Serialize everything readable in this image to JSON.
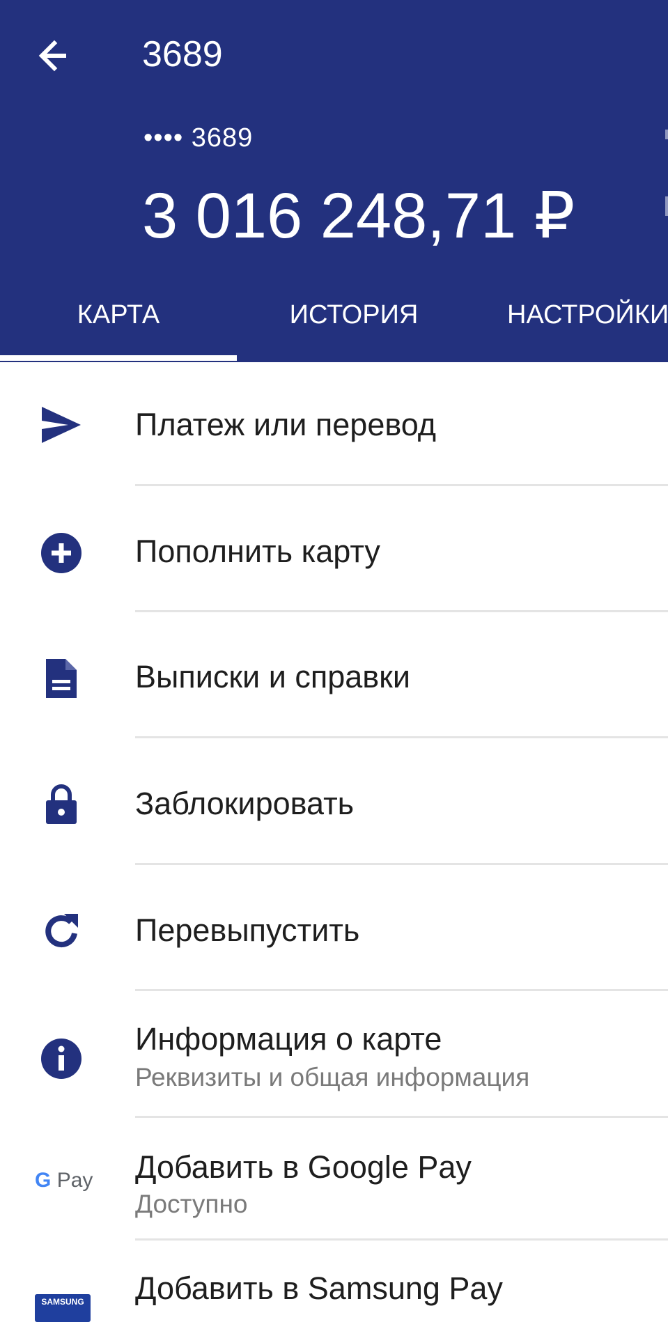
{
  "header": {
    "title": "3689",
    "masked_number": "•••• 3689",
    "balance": "3 016 248,71 ₽",
    "background_color": "#23317e",
    "back_icon": "arrow-left-icon"
  },
  "tabs": [
    {
      "label": "КАРТА",
      "active": true
    },
    {
      "label": "ИСТОРИЯ",
      "active": false
    },
    {
      "label": "НАСТРОЙКИ",
      "active": false
    }
  ],
  "menu": {
    "items": [
      {
        "label": "Платеж или перевод",
        "icon": "send-icon"
      },
      {
        "label": "Пополнить карту",
        "icon": "add-circle-icon"
      },
      {
        "label": "Выписки и справки",
        "icon": "document-icon"
      },
      {
        "label": "Заблокировать",
        "icon": "lock-icon"
      },
      {
        "label": "Перевыпустить",
        "icon": "refresh-icon"
      },
      {
        "label": "Информация о карте",
        "subtitle": "Реквизиты и общая информация",
        "icon": "info-icon"
      },
      {
        "label": "Добавить в Google Pay",
        "subtitle": "Доступно",
        "icon": "google-pay-icon",
        "icon_text": "G Pay"
      },
      {
        "label": "Добавить в Samsung Pay",
        "icon": "samsung-pay-icon",
        "icon_text": "SAMSUNG PAY"
      }
    ]
  },
  "colors": {
    "accent": "#23317e",
    "text": "#1e1e1e",
    "secondary_text": "#7a7a7a",
    "divider": "#e4e4e4"
  }
}
